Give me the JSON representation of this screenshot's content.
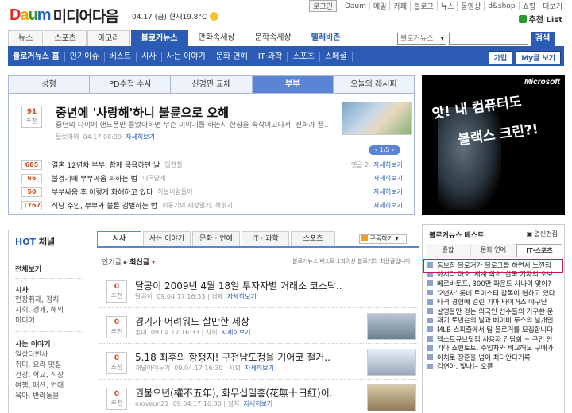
{
  "header": {
    "logo_daum": [
      "D",
      "a",
      "u",
      "m"
    ],
    "logo_media": "미디어다음",
    "date": "04.17 (금)  현재19.8°C",
    "weather_icon": "sun-icon",
    "top_links": [
      "Daum",
      "메일",
      "카페",
      "블로그",
      "뉴스",
      "동영상",
      "d&shop",
      "쇼핑",
      "더보기"
    ],
    "login": "로그인",
    "recommend": "추천 List"
  },
  "main_nav": {
    "tabs": [
      "뉴스",
      "스포츠",
      "아고라",
      "블로거뉴스",
      "만화속세상",
      "문학속세상",
      "텔레비존"
    ],
    "active": "블로거뉴스"
  },
  "search": {
    "scope": "블로거뉴스",
    "button": "검색"
  },
  "sub_nav": {
    "items": [
      "블로거뉴스 홈",
      "인기이슈",
      "베스트",
      "시사",
      "사는 이야기",
      "문화·연예",
      "IT·과학",
      "스포츠",
      "스페셜"
    ],
    "right_buttons": [
      "가입",
      "My글 보기"
    ]
  },
  "feature": {
    "tabs": [
      "성형",
      "PD수첩 수사",
      "신경민 교체",
      "부부",
      "오늘의 레시피"
    ],
    "active_tab": "부부",
    "main": {
      "count": "91",
      "count_label": "추천",
      "headline": "중년에 '사랑해'하니 불륜으로 오해",
      "desc": "중년의 나이에 핸드폰만 들었다하면 무슨 이야기를 하는지 한참을 속삭이고나서, 전화가 끝..",
      "author": "털보아찌",
      "time": "04.17 08:09",
      "link": "자세히보기"
    },
    "pager": "1/5",
    "list": [
      {
        "count": "685",
        "title": "결혼 12년차 부부, 함께 목욕하던 날",
        "author": "임현철",
        "comment": "댓글 2",
        "link": "자세히보기"
      },
      {
        "count": "66",
        "title": "불경기때 부부싸움 피하는 법",
        "author": "미국알개",
        "comment": "",
        "link": "자세히보기"
      },
      {
        "count": "50",
        "title": "부부싸움 후 이렇게 화해하고 있다",
        "author": "하늘비람들이",
        "comment": "",
        "link": "자세히보기"
      },
      {
        "count": "1767",
        "title": "식당 주인, 부부와 불륜 감별하는 법",
        "author": "이윤기의 세상읽기, 책읽기",
        "comment": "",
        "link": "자세히보기"
      }
    ]
  },
  "ad": {
    "brand": "Microsoft",
    "line1": "앗! 내 컴퓨터도",
    "line2": "블랙스 크린?!"
  },
  "hot_channel": {
    "title_hot": "HOT",
    "title_rest": " 채널",
    "all": "전체보기",
    "sections": [
      {
        "title": "시사",
        "items": [
          "현장취재, 정치",
          "사회, 경제, 해외",
          "미디어"
        ]
      },
      {
        "title": "사는 이야기",
        "items": [
          "일상다반사",
          "취미, 요리 맛집",
          "건강, 학교, 직장",
          "여행, 패션, 연애",
          "육아, 반려동물"
        ]
      }
    ]
  },
  "center": {
    "tabs": [
      "시사",
      "사는 이야기",
      "문화 · 연예",
      "IT · 과학",
      "스포츠"
    ],
    "active_tab": "시사",
    "rss": "구독하기",
    "sort_prev": "인기글",
    "sort_on": "최신글",
    "note": "블로거뉴스 베스트 1회이상 블로거의 최신글입니다",
    "items": [
      {
        "count": "0",
        "label": "추천",
        "title": "달공이 2009년 4월 18일 투자자별 거래소 코스닥..",
        "author": "달공이",
        "time": "09.04.17 16:33",
        "section": "경제",
        "link": "자세히보기"
      },
      {
        "count": "0",
        "label": "추천",
        "title": "경기가 어려워도 살만한 세상",
        "author": "혼미",
        "time": "09.04.17 16:33",
        "section": "사회",
        "link": "자세히보기"
      },
      {
        "count": "0",
        "label": "추천",
        "title": "5.18 최후의 항쟁지! 구전남도청을 기어코 철거..",
        "author": "채널아이누기",
        "time": "09.04.17 16:30",
        "section": "사회",
        "link": "자세히보기"
      },
      {
        "count": "0",
        "label": "추천",
        "title": "권불오년(權不五年), 화무십일홍(花無十日紅)이..",
        "author": "moveon21",
        "time": "09.04.17 16:30",
        "section": "정치",
        "link": "자세히보기"
      }
    ]
  },
  "best": {
    "title": "블로거뉴스 베스트",
    "options": "열린편집",
    "tabs": [
      "종합",
      "문화 연예",
      "IT·스포츠"
    ],
    "active_tab": "IT·스포츠",
    "items": [
      "동보장 블로거가 블로그를 하면서 느낀점",
      "아시다 마오 '세계 최초',한국 기자의 오보",
      "베르바토프, 300만 파운드 사나이 맞아?",
      "'2년차' 롯데 로이스터 감독이 변하고 있다",
      "타격 경험에 걸린 기아 타이거즈 야구단",
      "살영을만 걷는 외국인 선수들의 기구한 운",
      "재기 로빈슨의 날과 베이비 루스의 날개인",
      "MLB 스피즐에서 팀 블로거를 모집합니다",
      "텍스트큐브닷컴 사용자 간담회 ~ 구민 안",
      "기아 쇼핸토트, 수입차와 비교해도 구매가",
      "이치로 장훈을 넘어 최다안타기록",
      "김연아, 빛나는 오륜"
    ]
  }
}
